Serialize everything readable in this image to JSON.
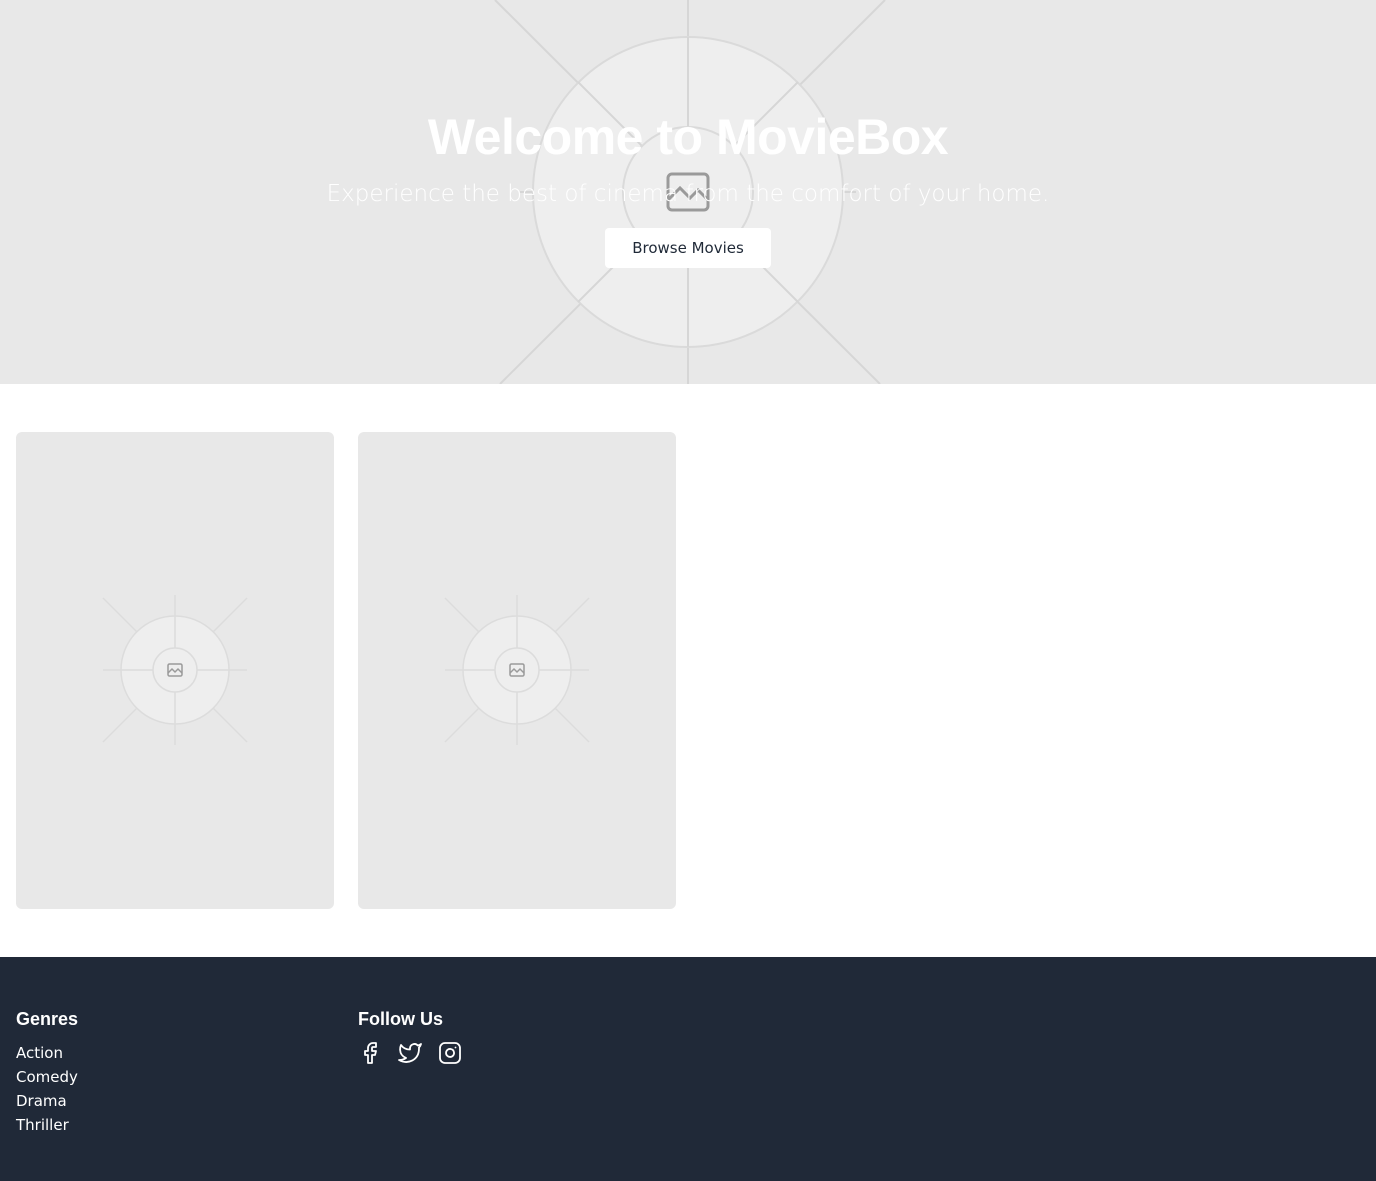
{
  "hero": {
    "title": "Welcome to MovieBox",
    "subtitle": "Experience the best of cinema from the comfort of your home.",
    "button_label": "Browse Movies",
    "background_image": "image-placeholder-icon"
  },
  "movie_cards": [
    {
      "image": "image-placeholder-icon"
    },
    {
      "image": "image-placeholder-icon"
    }
  ],
  "footer": {
    "genres_heading": "Genres",
    "genres": [
      "Action",
      "Comedy",
      "Drama",
      "Thriller"
    ],
    "follow_heading": "Follow Us",
    "social_icons": [
      "facebook-icon",
      "twitter-icon",
      "instagram-icon"
    ]
  },
  "colors": {
    "hero_bg": "#e8e8e8",
    "footer_bg": "#202938",
    "text_light": "#ffffff",
    "text_dark": "#1f2937"
  }
}
